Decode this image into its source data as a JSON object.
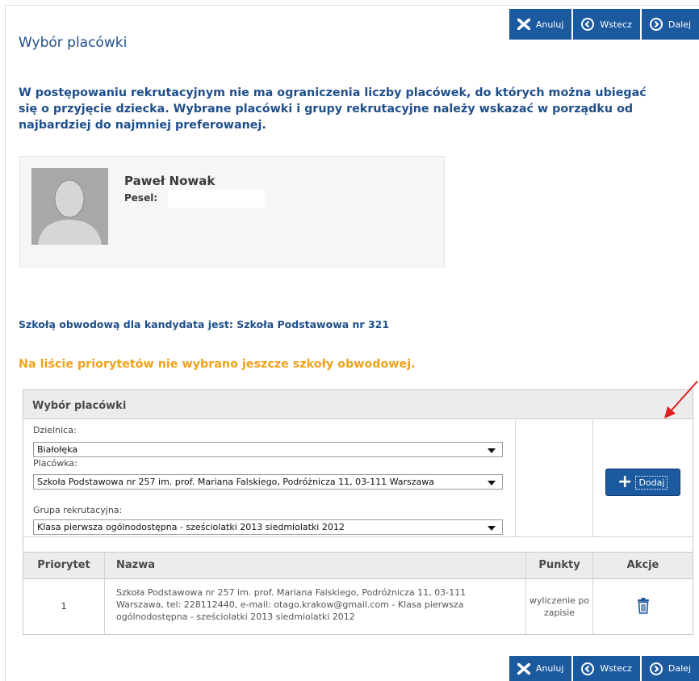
{
  "nav": {
    "cancel_label": "Anuluj",
    "back_label": "Wstecz",
    "next_label": "Dalej"
  },
  "page": {
    "title": "Wybór placówki",
    "intro": "W postępowaniu rekrutacyjnym nie ma ograniczenia liczby placówek, do których można ubiegać się o przyjęcie dziecka. Wybrane placówki i grupy rekrutacyjne należy wskazać w porządku od najbardziej do najmniej preferowanej."
  },
  "candidate": {
    "name": "Paweł Nowak",
    "pesel_label": "Pesel:"
  },
  "district_school_text": "Szkołą obwodową dla kandydata jest: Szkoła Podstawowa nr 321",
  "warning_text": "Na liście priorytetów nie wybrano jeszcze szkoły obwodowej.",
  "panel": {
    "title": "Wybór placówki",
    "district_label": "Dzielnica:",
    "district_value": "Białołęka",
    "facility_label": "Placówka:",
    "facility_value": "Szkoła Podstawowa nr 257 im. prof. Mariana Falskiego, Podróżnicza 11, 03-111 Warszawa",
    "group_label": "Grupa rekrutacyjna:",
    "group_value": "Klasa pierwsza ogólnodostępna - sześciolatki 2013 siedmiolatki 2012",
    "add_label": "Dodaj"
  },
  "table": {
    "headers": [
      "Priorytet",
      "Nazwa",
      "Punkty",
      "Akcje"
    ],
    "rows": [
      {
        "priority": "1",
        "name": "Szkoła Podstawowa nr 257 im. prof. Mariana Falskiego, Podróżnicza 11, 03-111 Warszawa, tel: 228112440, e-mail: otago.krakow@gmail.com - Klasa pierwsza ogólnodostępna - sześciolatki 2013 siedmiolatki 2012",
        "points": "wyliczenie po zapisie",
        "action_icon": "trash-icon"
      }
    ]
  },
  "colors": {
    "primary": "#1c5aa0",
    "heading": "#1f4f8a",
    "warning": "#f0a21b",
    "annotation_arrow": "#e02020"
  }
}
